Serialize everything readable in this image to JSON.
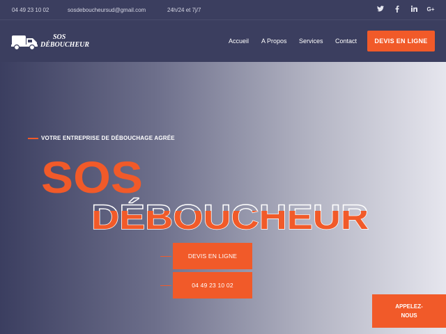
{
  "topbar": {
    "phone": "04 49 23 10 02",
    "email": "sosdeboucheursud@gmail.com",
    "hours": "24h/24 et 7j/7",
    "social_icons": [
      "twitter-icon",
      "facebook-icon",
      "linkedin-icon",
      "google-plus-icon"
    ]
  },
  "navbar": {
    "logo_line1": "SOS",
    "logo_line2": "DÉBOUCHEUR",
    "links": [
      "Accueil",
      "A Propos",
      "Services",
      "Contact"
    ],
    "cta": "DEVIS EN LIGNE"
  },
  "hero": {
    "tagline": "VOTRE ENTREPRISE DE DÉBOUCHAGE AGRÉE",
    "title_line1": "SOS",
    "title_line2": "DÉBOUCHEUR",
    "btn_devis": "DEVIS EN LIGNE",
    "btn_phone": "04 49 23 10 02"
  },
  "floating": {
    "call_line1": "APPELEZ-",
    "call_line2": "NOUS"
  },
  "colors": {
    "accent": "#f15a29",
    "navy": "#3b3e5f"
  }
}
